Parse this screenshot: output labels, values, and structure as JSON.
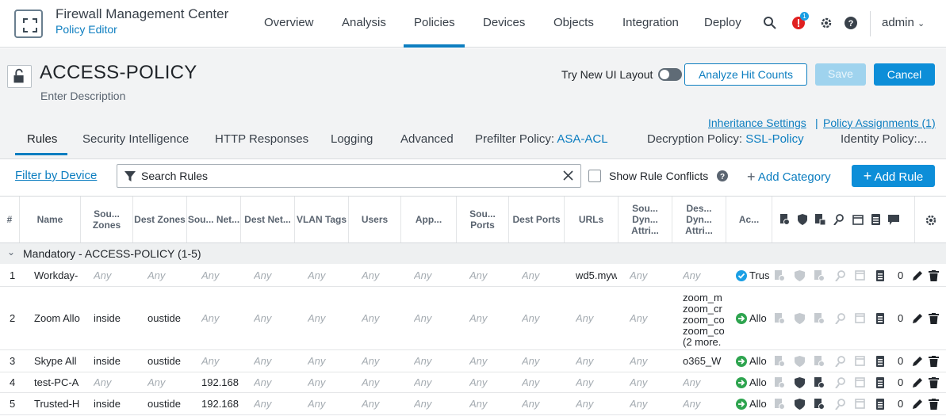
{
  "header": {
    "app_title": "Firewall Management Center",
    "app_subtitle": "Policy Editor",
    "nav": [
      "Overview",
      "Analysis",
      "Policies",
      "Devices",
      "Objects",
      "Integration",
      "Deploy"
    ],
    "active_nav": "Policies",
    "alert_count": "1",
    "user": "admin"
  },
  "policy": {
    "name": "ACCESS-POLICY",
    "description": "Enter Description",
    "try_new_ui": "Try New UI Layout",
    "analyze_btn": "Analyze Hit Counts",
    "save_btn": "Save",
    "cancel_btn": "Cancel",
    "inheritance": "Inheritance Settings",
    "assignments": "Policy Assignments (1)",
    "tabs": [
      "Rules",
      "Security Intelligence",
      "HTTP Responses",
      "Logging",
      "Advanced"
    ],
    "prefilter_label": "Prefilter Policy:",
    "prefilter_value": "ASA-ACL",
    "decryption_label": "Decryption Policy:",
    "decryption_value": "SSL-Policy",
    "identity_label": "Identity Policy:..."
  },
  "toolbar": {
    "filter_by_device": "Filter by Device",
    "search_placeholder": "Search Rules",
    "show_conflicts": "Show Rule Conflicts",
    "add_category": "Add Category",
    "add_rule": "Add Rule"
  },
  "table": {
    "headers": [
      "#",
      "Name",
      "Sou... Zones",
      "Dest Zones",
      "Sou... Net...",
      "Dest Net...",
      "VLAN Tags",
      "Users",
      "App...",
      "Sou... Ports",
      "Dest Ports",
      "URLs",
      "Sou... Dyn... Attri...",
      "Des... Dyn... Attri...",
      "Ac..."
    ],
    "group": "Mandatory - ACCESS-POLICY (1-5)",
    "any": "Any",
    "rows": [
      {
        "num": "1",
        "name": "Workday-",
        "src_zone": "Any",
        "dst_zone": "Any",
        "src_net": "Any",
        "urls": "wd5.myw",
        "action": "Trus",
        "dyn": "Any",
        "hits": "0"
      },
      {
        "num": "2",
        "name": "Zoom Allo",
        "src_zone": "inside",
        "dst_zone": "oustide",
        "src_net": "Any",
        "urls": "Any",
        "action": "Allo",
        "dyn_lines": [
          "zoom_m",
          "zoom_cr",
          "zoom_co",
          "zoom_co",
          "(2 more."
        ],
        "hits": "0"
      },
      {
        "num": "3",
        "name": "Skype All",
        "src_zone": "inside",
        "dst_zone": "oustide",
        "src_net": "Any",
        "urls": "Any",
        "action": "Allo",
        "dyn": "o365_W",
        "hits": "0"
      },
      {
        "num": "4",
        "name": "test-PC-A",
        "src_zone": "Any",
        "dst_zone": "Any",
        "src_net": "192.168",
        "urls": "Any",
        "action": "Allo",
        "dyn": "Any",
        "hits": "0"
      },
      {
        "num": "5",
        "name": "Trusted-H",
        "src_zone": "inside",
        "dst_zone": "oustide",
        "src_net": "192.168",
        "urls": "Any",
        "action": "Allo",
        "dyn": "Any",
        "hits": "0"
      }
    ]
  },
  "colors": {
    "accent": "#0d7ec0",
    "allow": "#2ea44f",
    "trust": "#1b9fe4",
    "alert": "#e02020"
  }
}
